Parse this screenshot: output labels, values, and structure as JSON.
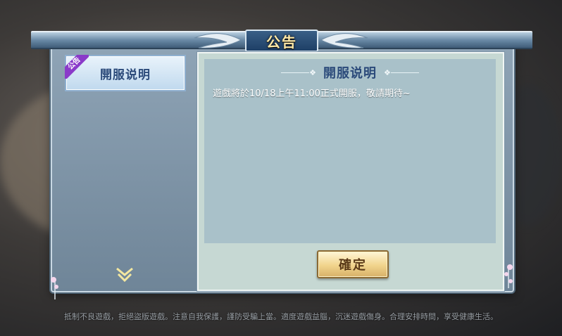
{
  "dialog": {
    "title": "公告",
    "tab": {
      "badge": "公告",
      "label": "開服说明"
    },
    "content": {
      "heading": "開服说明",
      "body": "遊戲將於10/18上午11:00正式開服，敬請期待~"
    },
    "confirm_label": "確定"
  },
  "footer": {
    "notice": "抵制不良遊戲，拒絕盜版遊戲。注意自我保護，謹防受騙上當。適度遊戲益腦，沉迷遊戲傷身。合理安排時間，享受健康生活。"
  },
  "colors": {
    "accent_purple": "#8a3ac9",
    "title_gold": "#ffe9a8",
    "button_gold": "#f1d48c",
    "panel_blue": "#6f8598"
  },
  "icons": [
    "scroll-down-chevron-icon",
    "flower-ornament-icon",
    "wing-ornament-icon"
  ]
}
